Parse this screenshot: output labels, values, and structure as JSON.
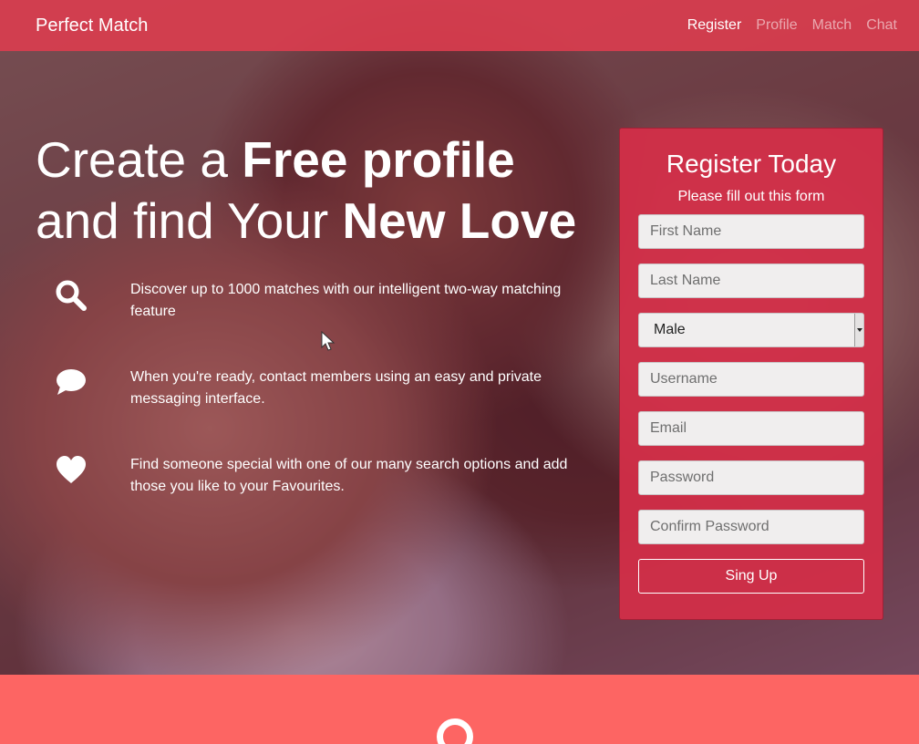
{
  "navbar": {
    "brand": "Perfect Match",
    "links": [
      {
        "label": "Register",
        "active": true
      },
      {
        "label": "Profile",
        "active": false
      },
      {
        "label": "Match",
        "active": false
      },
      {
        "label": "Chat",
        "active": false
      }
    ]
  },
  "hero": {
    "line1_light": "Create a ",
    "line1_bold": "Free profile",
    "line2_light": "and find Your ",
    "line2_bold": "New Love",
    "features": [
      {
        "icon": "search-icon",
        "text": "Discover up to 1000 matches with our intelligent two-way matching feature"
      },
      {
        "icon": "chat-bubble-icon",
        "text": "When you're ready, contact members using an easy and private messaging interface."
      },
      {
        "icon": "heart-icon",
        "text": "Find someone special with one of our many search options and add those you like to your Favourites."
      }
    ]
  },
  "register": {
    "title": "Register Today",
    "subtitle": "Please fill out this form",
    "first_name_placeholder": "First Name",
    "last_name_placeholder": "Last Name",
    "gender_value": "Male",
    "username_placeholder": "Username",
    "email_placeholder": "Email",
    "password_placeholder": "Password",
    "confirm_password_placeholder": "Confirm Password",
    "submit_label": "Sing Up"
  },
  "colors": {
    "navbar": "#de3c4e",
    "form_bg": "#d42e48",
    "bottom_section": "#fd6563"
  }
}
